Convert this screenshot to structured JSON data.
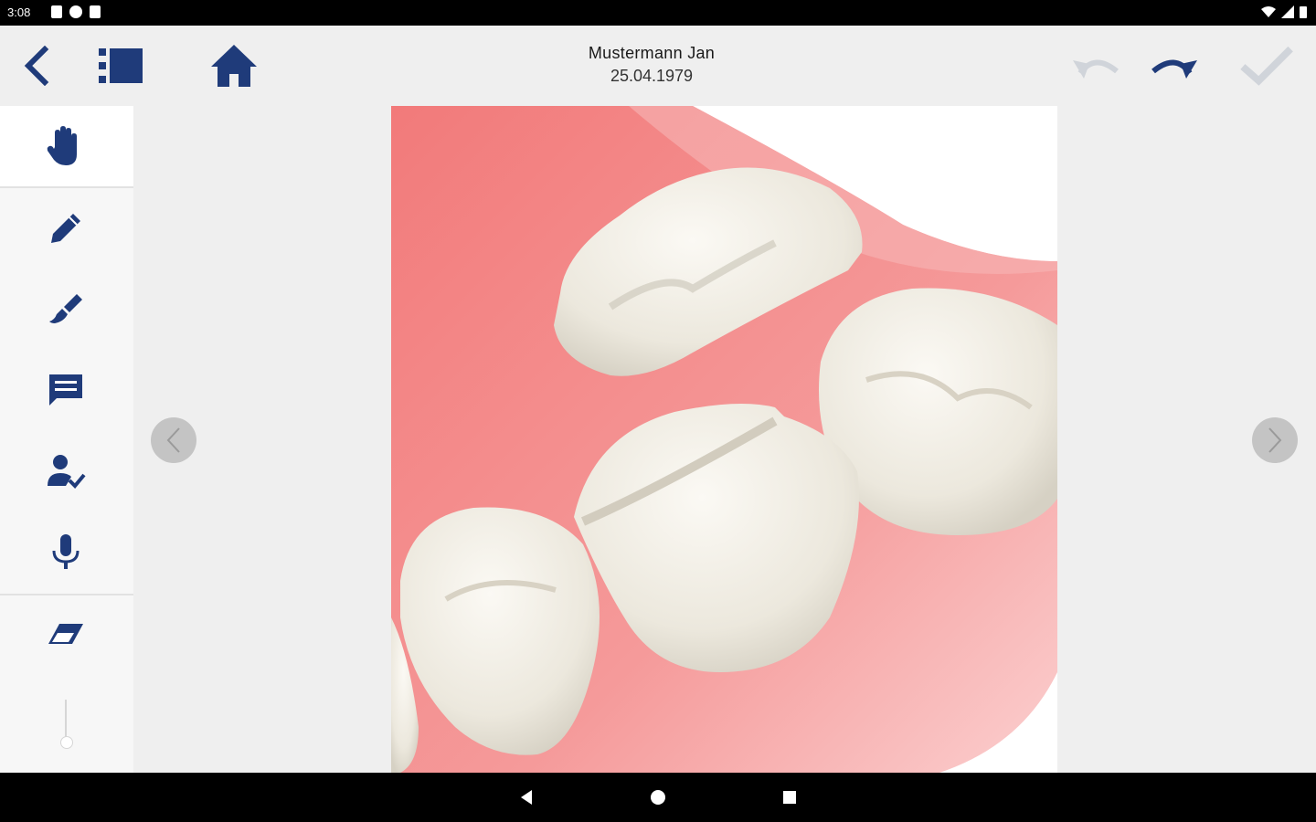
{
  "status_bar": {
    "time": "3:08",
    "left_icons": [
      "notification-icon",
      "app-icon",
      "sd-card-icon"
    ],
    "right_icons": [
      "wifi-icon",
      "signal-icon",
      "battery-icon"
    ]
  },
  "header": {
    "patient_name": "Mustermann Jan",
    "patient_dob": "25.04.1979",
    "icons": [
      "back-arrow-icon",
      "sidebar-list-icon",
      "home-icon",
      "undo-icon",
      "redo-icon",
      "confirm-check-icon"
    ]
  },
  "tools": [
    {
      "name": "pan-hand",
      "icon": "hand-icon"
    },
    {
      "name": "pencil",
      "icon": "pencil-icon"
    },
    {
      "name": "marker",
      "icon": "brush-icon"
    },
    {
      "name": "comment",
      "icon": "comment-icon"
    },
    {
      "name": "signature",
      "icon": "user-check-icon"
    },
    {
      "name": "voice",
      "icon": "microphone-icon"
    },
    {
      "name": "eraser",
      "icon": "eraser-icon"
    }
  ],
  "image": {
    "subject": "dental-crown-illustration"
  },
  "colors": {
    "accent": "#1f3b7a",
    "disabled": "#d0d4da",
    "gum": "#f08c8c",
    "tooth": "#eeeae0"
  }
}
